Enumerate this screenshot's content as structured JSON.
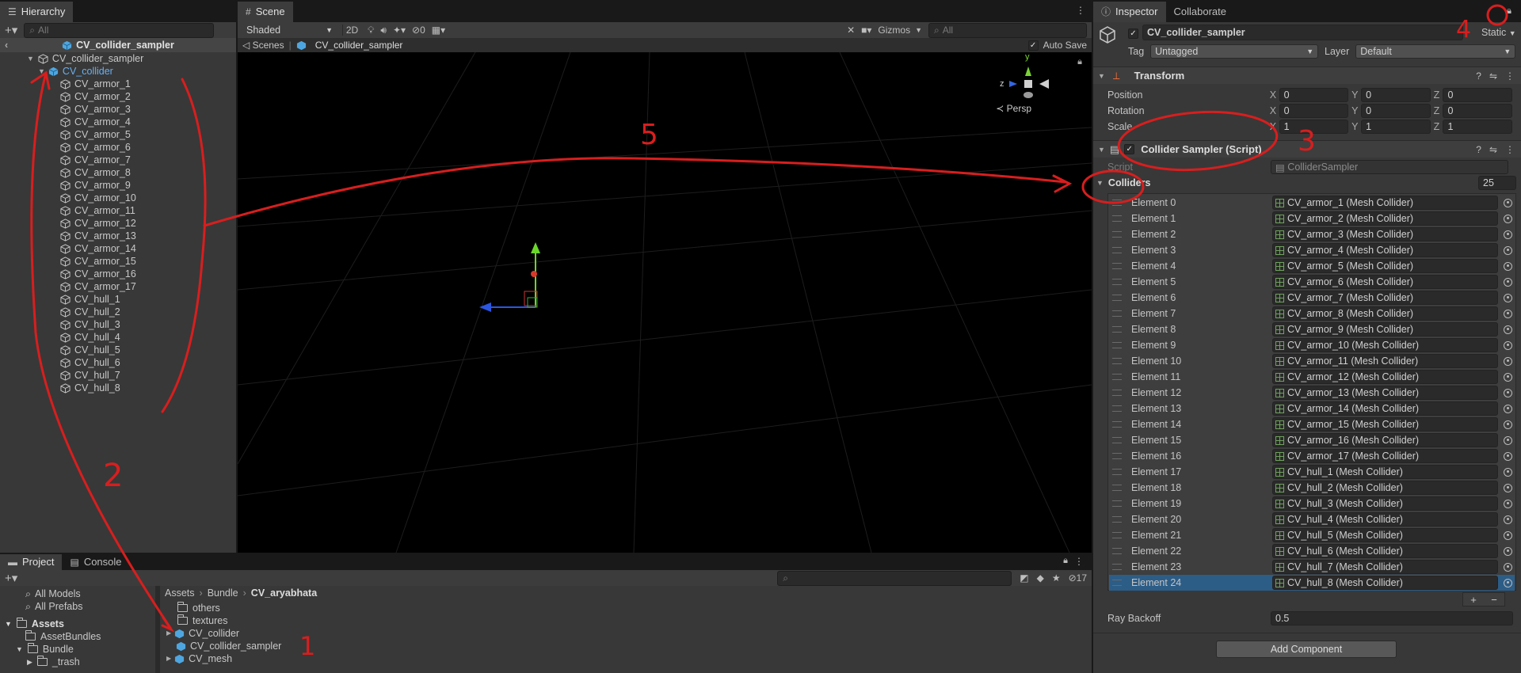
{
  "hierarchy": {
    "tab_label": "Hierarchy",
    "search_placeholder": "All",
    "scene_title": "CV_collider_sampler",
    "root": "CV_collider_sampler",
    "selected_child": "CV_collider",
    "items": [
      "CV_armor_1",
      "CV_armor_2",
      "CV_armor_3",
      "CV_armor_4",
      "CV_armor_5",
      "CV_armor_6",
      "CV_armor_7",
      "CV_armor_8",
      "CV_armor_9",
      "CV_armor_10",
      "CV_armor_11",
      "CV_armor_12",
      "CV_armor_13",
      "CV_armor_14",
      "CV_armor_15",
      "CV_armor_16",
      "CV_armor_17",
      "CV_hull_1",
      "CV_hull_2",
      "CV_hull_3",
      "CV_hull_4",
      "CV_hull_5",
      "CV_hull_6",
      "CV_hull_7",
      "CV_hull_8"
    ]
  },
  "scene": {
    "tab_label": "Scene",
    "shading_mode": "Shaded",
    "mode_2d": "2D",
    "hidden_count": "0",
    "gizmos_label": "Gizmos",
    "search_placeholder": "All",
    "breadcrumb_root": "Scenes",
    "breadcrumb_current": "CV_collider_sampler",
    "auto_save_label": "Auto Save",
    "persp_label": "Persp",
    "axis_y": "y",
    "axis_z": "z"
  },
  "inspector": {
    "tab_label": "Inspector",
    "collab_tab_label": "Collaborate",
    "object_name": "CV_collider_sampler",
    "static_label": "Static",
    "tag_label": "Tag",
    "tag_value": "Untagged",
    "layer_label": "Layer",
    "layer_value": "Default",
    "transform": {
      "title": "Transform",
      "position_label": "Position",
      "rotation_label": "Rotation",
      "scale_label": "Scale",
      "x": "X",
      "y": "Y",
      "z": "Z",
      "position": [
        "0",
        "0",
        "0"
      ],
      "rotation": [
        "0",
        "0",
        "0"
      ],
      "scale": [
        "1",
        "1",
        "1"
      ]
    },
    "script_component": {
      "title": "Collider Sampler (Script)",
      "script_label": "Script",
      "script_value": "ColliderSampler",
      "colliders_label": "Colliders",
      "colliders_count": "25",
      "element_prefix": "Element",
      "elements": [
        "CV_armor_1 (Mesh Collider)",
        "CV_armor_2 (Mesh Collider)",
        "CV_armor_3 (Mesh Collider)",
        "CV_armor_4 (Mesh Collider)",
        "CV_armor_5 (Mesh Collider)",
        "CV_armor_6 (Mesh Collider)",
        "CV_armor_7 (Mesh Collider)",
        "CV_armor_8 (Mesh Collider)",
        "CV_armor_9 (Mesh Collider)",
        "CV_armor_10 (Mesh Collider)",
        "CV_armor_11 (Mesh Collider)",
        "CV_armor_12 (Mesh Collider)",
        "CV_armor_13 (Mesh Collider)",
        "CV_armor_14 (Mesh Collider)",
        "CV_armor_15 (Mesh Collider)",
        "CV_armor_16 (Mesh Collider)",
        "CV_armor_17 (Mesh Collider)",
        "CV_hull_1 (Mesh Collider)",
        "CV_hull_2 (Mesh Collider)",
        "CV_hull_3 (Mesh Collider)",
        "CV_hull_4 (Mesh Collider)",
        "CV_hull_5 (Mesh Collider)",
        "CV_hull_6 (Mesh Collider)",
        "CV_hull_7 (Mesh Collider)",
        "CV_hull_8 (Mesh Collider)"
      ],
      "selected_element_index": 24,
      "ray_backoff_label": "Ray Backoff",
      "ray_backoff_value": "0.5"
    },
    "add_component_label": "Add Component"
  },
  "project": {
    "tab_label": "Project",
    "console_tab_label": "Console",
    "hidden_count": "17",
    "sidebar": [
      "All Models",
      "All Prefabs"
    ],
    "assets_label": "Assets",
    "asset_bundles_label": "AssetBundles",
    "bundle_label": "Bundle",
    "trash_label": "_trash",
    "breadcrumb": [
      "Assets",
      "Bundle",
      "CV_aryabhata"
    ],
    "files": [
      "others",
      "textures",
      "CV_collider",
      "CV_collider_sampler",
      "CV_mesh"
    ]
  },
  "annotations": [
    "1",
    "2",
    "3",
    "4",
    "5"
  ],
  "colors": {
    "accent_selection": "#2c5d87",
    "annotation_red": "#d81e1e",
    "mesh_icon_green": "#6fa25c"
  }
}
